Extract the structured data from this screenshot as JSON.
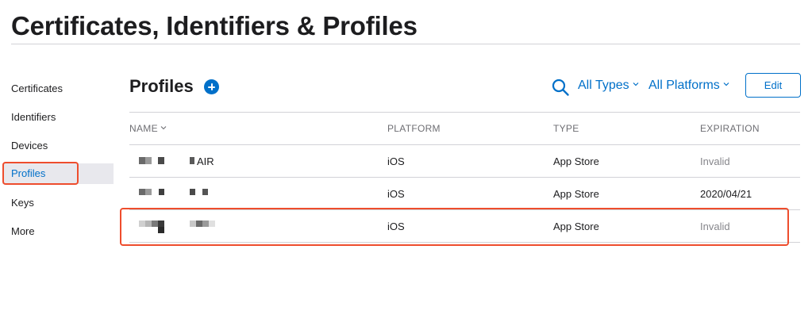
{
  "page_title": "Certificates, Identifiers & Profiles",
  "sidebar": {
    "items": [
      {
        "label": "Certificates"
      },
      {
        "label": "Identifiers"
      },
      {
        "label": "Devices"
      },
      {
        "label": "Profiles",
        "active": true
      },
      {
        "label": "Keys"
      },
      {
        "label": "More"
      }
    ]
  },
  "main": {
    "heading": "Profiles",
    "add_icon": "plus-circle-icon",
    "search_icon": "search-icon",
    "filters": {
      "types": "All Types",
      "platforms": "All Platforms"
    },
    "edit_label": "Edit"
  },
  "table": {
    "headers": {
      "name": "NAME",
      "platform": "PLATFORM",
      "type": "TYPE",
      "expiration": "EXPIRATION"
    },
    "rows": [
      {
        "name_suffix": "AIR",
        "platform": "iOS",
        "type": "App Store",
        "expiration": "Invalid"
      },
      {
        "name_suffix": "",
        "platform": "iOS",
        "type": "App Store",
        "expiration": "2020/04/21"
      },
      {
        "name_suffix": "",
        "platform": "iOS",
        "type": "App Store",
        "expiration": "Invalid"
      }
    ]
  },
  "colors": {
    "accent": "#0070c9",
    "annotation": "#ee4d2d",
    "muted_text": "#86868b"
  }
}
